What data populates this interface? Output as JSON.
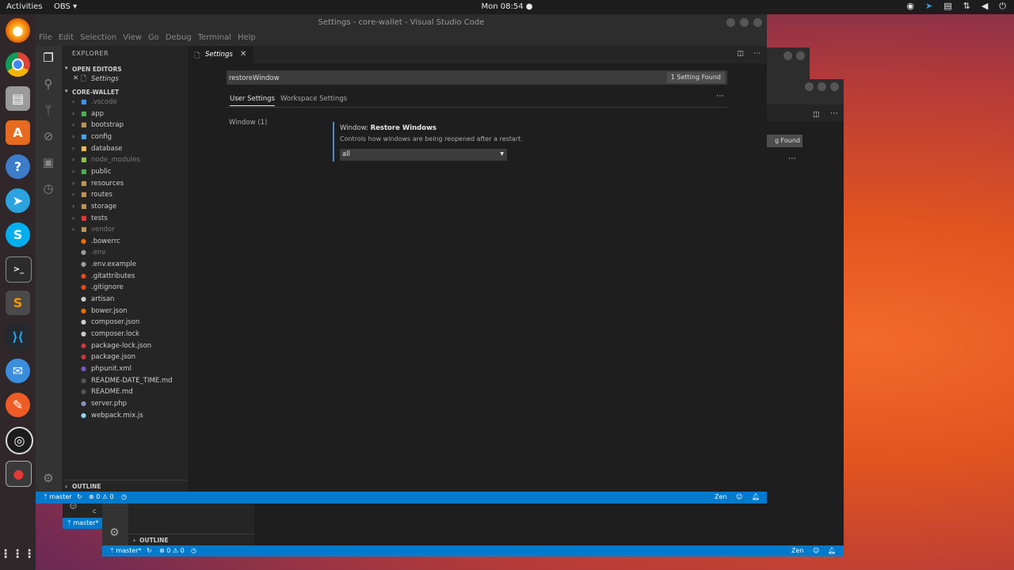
{
  "topbar": {
    "activities": "Activities",
    "app_menu": "OBS ▾",
    "clock": "Mon 08:54 ●",
    "tray_icons": [
      "obs-tray-icon",
      "telegram-icon",
      "clipboard-icon",
      "network-icon",
      "volume-icon",
      "power-icon"
    ]
  },
  "dock": {
    "icons": [
      "firefox-icon",
      "chrome-icon",
      "files-icon",
      "software-icon",
      "help-icon",
      "telegram-icon",
      "skype-icon",
      "terminal-icon",
      "sublime-icon",
      "vscode-icon",
      "thunderbird-icon",
      "postman-icon",
      "obs-icon",
      "recorder-icon",
      "apps-grid-icon"
    ]
  },
  "window": {
    "title": "Settings - core-wallet - Visual Studio Code",
    "menu": [
      "File",
      "Edit",
      "Selection",
      "View",
      "Go",
      "Debug",
      "Terminal",
      "Help"
    ]
  },
  "sidebar": {
    "header": "EXPLORER",
    "open_editors": "OPEN EDITORS",
    "open_editor_item": "Settings",
    "project": "CORE-WALLET",
    "folders": [
      {
        "name": ".vscode",
        "dim": true,
        "icon_color": "#3794ff"
      },
      {
        "name": "app",
        "dim": false,
        "icon_color": "#4caf50"
      },
      {
        "name": "bootstrap",
        "dim": false,
        "icon_color": "#c09553"
      },
      {
        "name": "config",
        "dim": false,
        "icon_color": "#42a5f5"
      },
      {
        "name": "database",
        "dim": false,
        "icon_color": "#ffb74d"
      },
      {
        "name": "node_modules",
        "dim": true,
        "icon_color": "#8bc34a"
      },
      {
        "name": "public",
        "dim": false,
        "icon_color": "#4caf50"
      },
      {
        "name": "resources",
        "dim": false,
        "icon_color": "#c09553"
      },
      {
        "name": "routes",
        "dim": false,
        "icon_color": "#c09553"
      },
      {
        "name": "storage",
        "dim": false,
        "icon_color": "#c09553"
      },
      {
        "name": "tests",
        "dim": false,
        "icon_color": "#e53935"
      },
      {
        "name": "vendor",
        "dim": true,
        "icon_color": "#c09553"
      }
    ],
    "files": [
      {
        "name": ".bowerrc",
        "dim": false,
        "icon_color": "#ef6c00"
      },
      {
        "name": ".env",
        "dim": true,
        "icon_color": "#9e9e9e"
      },
      {
        "name": ".env.example",
        "dim": false,
        "icon_color": "#9e9e9e"
      },
      {
        "name": ".gitattributes",
        "dim": false,
        "icon_color": "#e64a19"
      },
      {
        "name": ".gitignore",
        "dim": false,
        "icon_color": "#e64a19"
      },
      {
        "name": "artisan",
        "dim": false,
        "icon_color": "#cccccc"
      },
      {
        "name": "bower.json",
        "dim": false,
        "icon_color": "#ef6c00"
      },
      {
        "name": "composer.json",
        "dim": false,
        "icon_color": "#cccccc"
      },
      {
        "name": "composer.lock",
        "dim": false,
        "icon_color": "#cccccc"
      },
      {
        "name": "package-lock.json",
        "dim": false,
        "icon_color": "#cb3837"
      },
      {
        "name": "package.json",
        "dim": false,
        "icon_color": "#cb3837"
      },
      {
        "name": "phpunit.xml",
        "dim": false,
        "icon_color": "#7e57c2"
      },
      {
        "name": "README-DATE_TIME.md",
        "dim": false,
        "icon_color": "#555555"
      },
      {
        "name": "README.md",
        "dim": false,
        "icon_color": "#555555"
      },
      {
        "name": "server.php",
        "dim": false,
        "icon_color": "#8892bf"
      },
      {
        "name": "webpack.mix.js",
        "dim": false,
        "icon_color": "#8ed6fb"
      }
    ],
    "outline": "OUTLINE"
  },
  "editor": {
    "tab_label": "Settings",
    "search_value": "restoreWindow",
    "found_badge": "1 Setting Found",
    "settings_tabs": [
      "User Settings",
      "Workspace Settings"
    ],
    "toc_item": "Window (1)",
    "setting": {
      "category": "Window: ",
      "name": "Restore Windows",
      "description": "Controls how windows are being reopened after a restart.",
      "value": "all"
    }
  },
  "statusbar": {
    "branch": "master",
    "errors": "0",
    "warnings": "0",
    "zen": "Zen",
    "color": "#007acc"
  },
  "bg_windows": {
    "badge_fragment": "g Found",
    "status_branch": "master*",
    "status_errors": "0",
    "status_warnings": "0",
    "outline": "OUTLINE",
    "zen": "Zen",
    "fragment_c": "c"
  }
}
